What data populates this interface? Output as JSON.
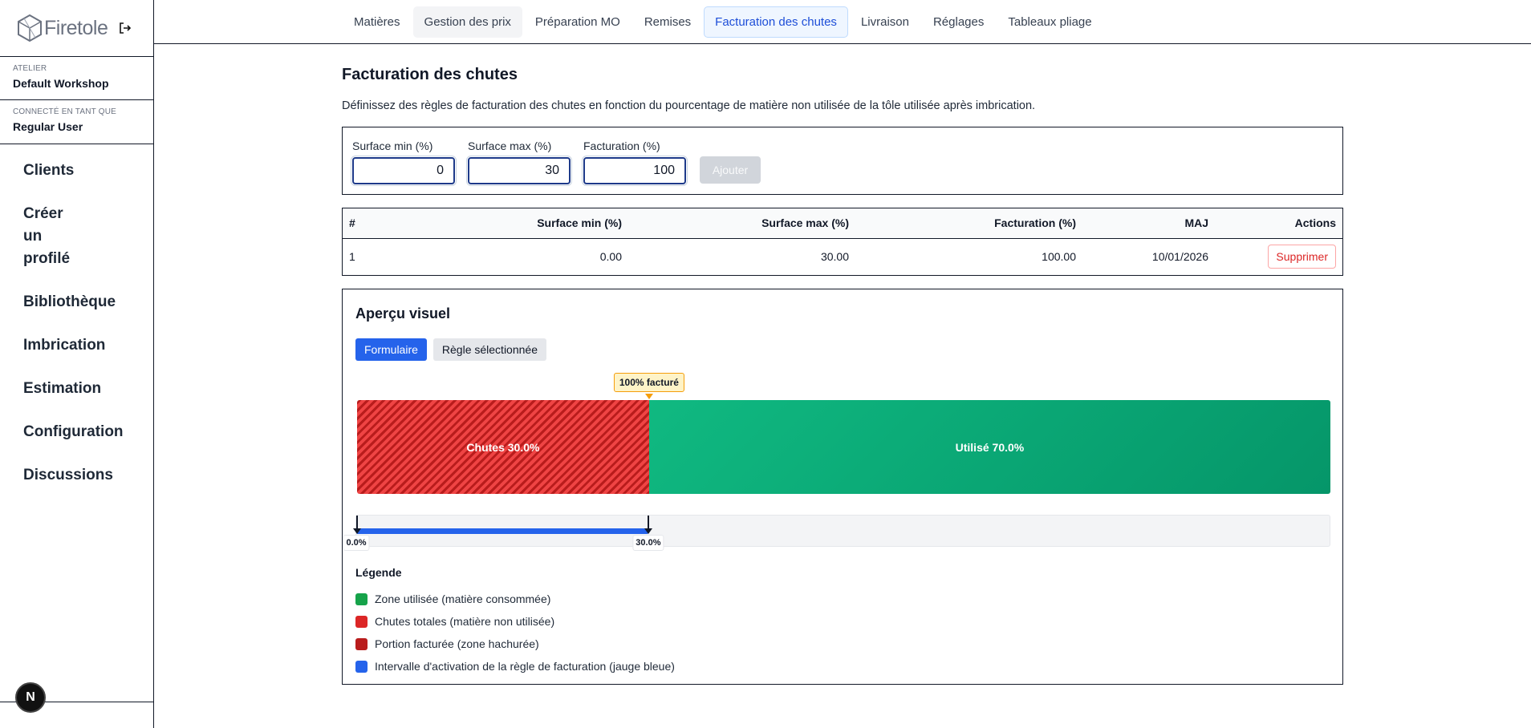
{
  "app": {
    "name": "Firetole"
  },
  "sidebar": {
    "atelier_label": "ATELIER",
    "atelier_value": "Default Workshop",
    "user_label": "CONNECTÉ EN TANT QUE",
    "user_value": "Regular User",
    "items": [
      {
        "label": "Clients"
      },
      {
        "label": "Créer un profilé"
      },
      {
        "label": "Bibliothèque"
      },
      {
        "label": "Imbrication"
      },
      {
        "label": "Estimation"
      },
      {
        "label": "Configuration"
      },
      {
        "label": "Discussions"
      }
    ],
    "badge": "N"
  },
  "tabs": [
    {
      "label": "Matières"
    },
    {
      "label": "Gestion des prix"
    },
    {
      "label": "Préparation MO"
    },
    {
      "label": "Remises"
    },
    {
      "label": "Facturation des chutes"
    },
    {
      "label": "Livraison"
    },
    {
      "label": "Réglages"
    },
    {
      "label": "Tableaux pliage"
    }
  ],
  "active_tab": "Facturation des chutes",
  "page": {
    "title": "Facturation des chutes",
    "description": "Définissez des règles de facturation des chutes en fonction du pourcentage de matière non utilisée de la tôle utilisée après imbrication."
  },
  "form": {
    "min_label": "Surface min (%)",
    "min_value": "0",
    "max_label": "Surface max (%)",
    "max_value": "30",
    "billing_label": "Facturation (%)",
    "billing_value": "100",
    "add_button": "Ajouter"
  },
  "table": {
    "headers": [
      "#",
      "Surface min (%)",
      "Surface max (%)",
      "Facturation (%)",
      "MAJ",
      "Actions"
    ],
    "rows": [
      {
        "id": "1",
        "min": "0.00",
        "max": "30.00",
        "billing": "100.00",
        "updated": "10/01/2026",
        "action": "Supprimer"
      }
    ]
  },
  "preview": {
    "title": "Aperçu visuel",
    "mode_buttons": [
      "Formulaire",
      "Règle sélectionnée"
    ],
    "active_mode": "Formulaire",
    "waste_percent": 30.0,
    "used_percent": 70.0,
    "waste_label": "Chutes 30.0%",
    "used_label": "Utilisé 70.0%",
    "billed_badge": "100% facturé",
    "gauge_min": 0.0,
    "gauge_max": 30.0,
    "gauge_min_label": "0.0%",
    "gauge_max_label": "30.0%"
  },
  "legend": {
    "title": "Légende",
    "items": [
      {
        "label": "Zone utilisée (matière consommée)",
        "color": "#16a34a"
      },
      {
        "label": "Chutes totales (matière non utilisée)",
        "color": "#dc2626"
      },
      {
        "label": "Portion facturée (zone hachurée)",
        "color": "#b91c1c"
      },
      {
        "label": "Intervalle d'activation de la règle de facturation (jauge bleue)",
        "color": "#2563eb"
      }
    ]
  },
  "colors": {
    "accent": "#2563eb",
    "danger": "#dc2626",
    "used": "#10b981"
  }
}
